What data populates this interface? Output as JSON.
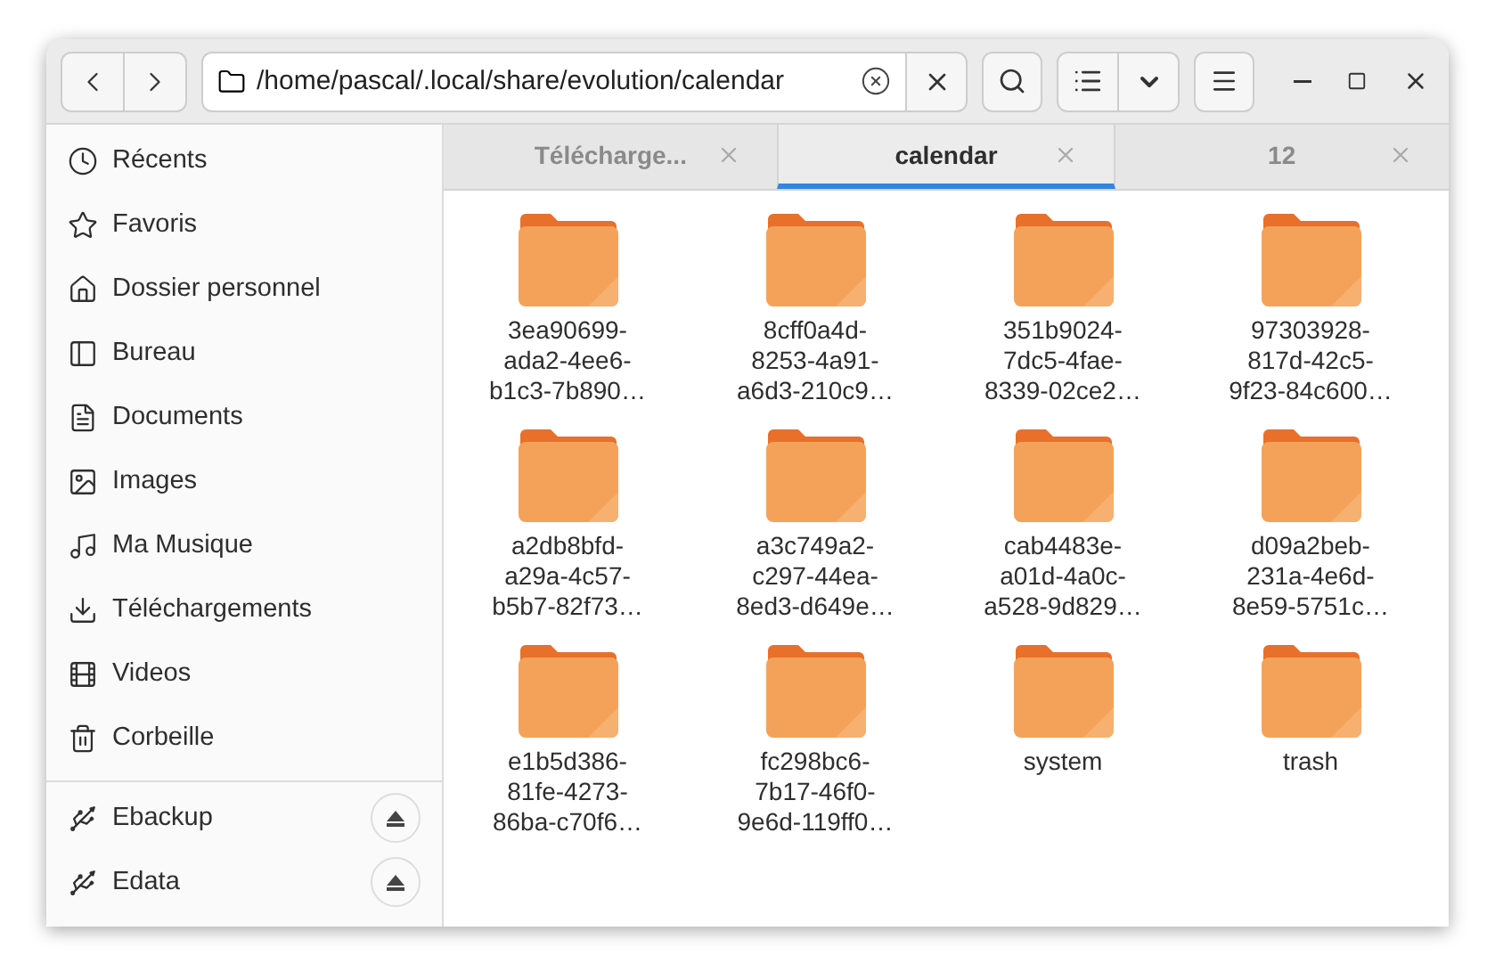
{
  "location": {
    "path": "/home/pascal/.local/share/evolution/calendar"
  },
  "tabs": [
    {
      "label": "Télécharge...",
      "selected": false
    },
    {
      "label": "calendar",
      "selected": true
    },
    {
      "label": "12",
      "selected": false
    }
  ],
  "sidebar": {
    "places": [
      {
        "label": "Récents"
      },
      {
        "label": "Favoris"
      },
      {
        "label": "Dossier personnel"
      },
      {
        "label": "Bureau"
      },
      {
        "label": "Documents"
      },
      {
        "label": "Images"
      },
      {
        "label": "Ma Musique"
      },
      {
        "label": "Téléchargements"
      },
      {
        "label": "Videos"
      },
      {
        "label": "Corbeille"
      }
    ],
    "devices": [
      {
        "label": "Ebackup"
      },
      {
        "label": "Edata"
      }
    ]
  },
  "files": [
    {
      "name_lines": [
        "3ea90699-",
        "ada2-4ee6-",
        "b1c3-7b890…"
      ]
    },
    {
      "name_lines": [
        "8cff0a4d-",
        "8253-4a91-",
        "a6d3-210c9…"
      ]
    },
    {
      "name_lines": [
        "351b9024-",
        "7dc5-4fae-",
        "8339-02ce2…"
      ]
    },
    {
      "name_lines": [
        "97303928-",
        "817d-42c5-",
        "9f23-84c600…"
      ]
    },
    {
      "name_lines": [
        "a2db8bfd-",
        "a29a-4c57-",
        "b5b7-82f73…"
      ]
    },
    {
      "name_lines": [
        "a3c749a2-",
        "c297-44ea-",
        "8ed3-d649e…"
      ]
    },
    {
      "name_lines": [
        "cab4483e-",
        "a01d-4a0c-",
        "a528-9d829…"
      ]
    },
    {
      "name_lines": [
        "d09a2beb-",
        "231a-4e6d-",
        "8e59-5751c…"
      ]
    },
    {
      "name_lines": [
        "e1b5d386-",
        "81fe-4273-",
        "86ba-c70f6…"
      ]
    },
    {
      "name_lines": [
        "fc298bc6-",
        "7b17-46f0-",
        "9e6d-119ff0…"
      ]
    },
    {
      "name_lines": [
        "system"
      ]
    },
    {
      "name_lines": [
        "trash"
      ]
    }
  ]
}
